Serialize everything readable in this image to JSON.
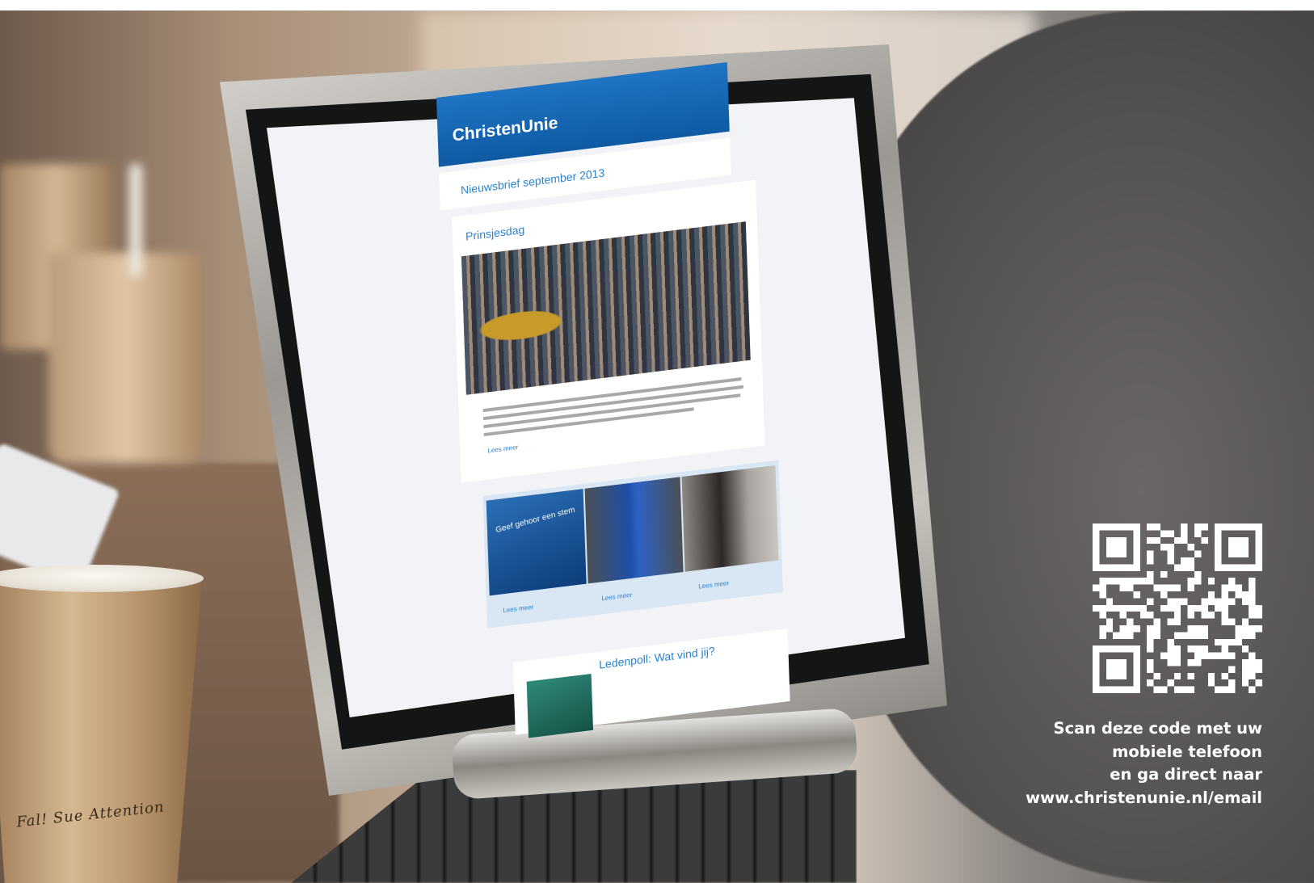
{
  "newsletter": {
    "brand": "ChristenUnie",
    "issue_title": "Nieuwsbrief september 2013",
    "lead_article_title": "Prinsjesdag",
    "lead_article_link": "Lees meer",
    "thumb1_caption": "Geef gehoor een stem",
    "read_more_links": [
      "Lees meer",
      "Lees meer",
      "Lees meer"
    ],
    "poll_title": "Ledenpoll: Wat vind jij?"
  },
  "cup_text": "Fal! Sue Attention",
  "qr": {
    "lines": [
      "Scan deze code met uw",
      "mobiele telefoon",
      "en ga direct naar",
      "www.christenunie.nl/email"
    ]
  },
  "colors": {
    "brand_blue": "#1f74c4",
    "link_blue": "#2a84d0",
    "caption_white": "#ffffff"
  }
}
